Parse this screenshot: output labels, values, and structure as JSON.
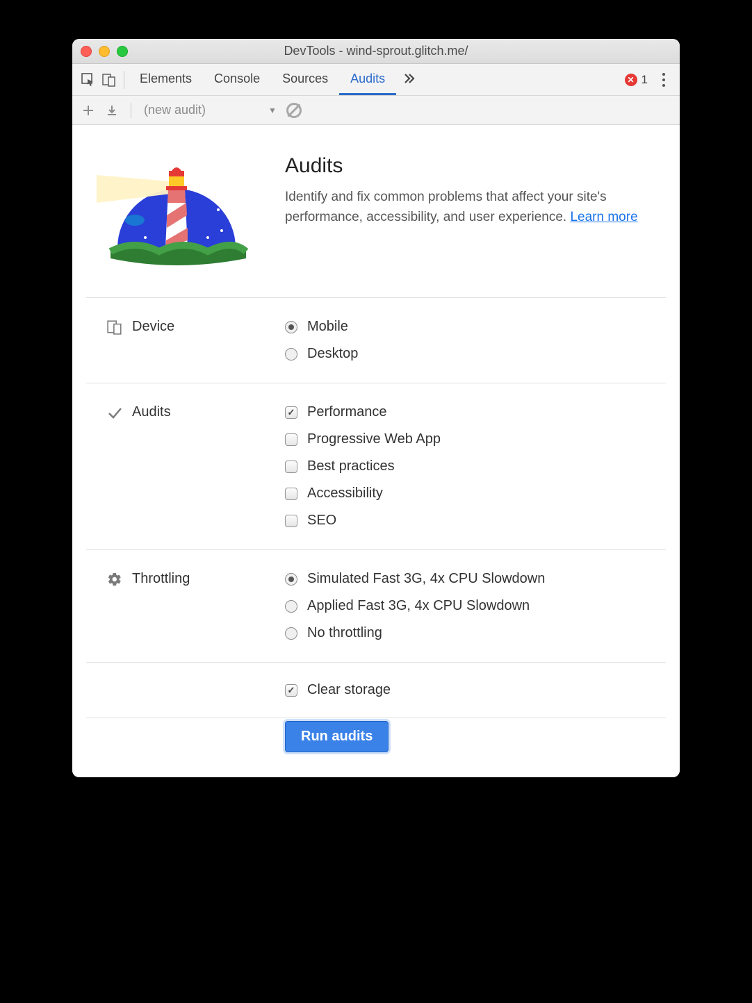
{
  "window": {
    "title": "DevTools - wind-sprout.glitch.me/"
  },
  "tabs": {
    "items": [
      "Elements",
      "Console",
      "Sources",
      "Audits"
    ],
    "active": "Audits",
    "error_count": "1"
  },
  "subbar": {
    "audit_select": "(new audit)"
  },
  "hero": {
    "title": "Audits",
    "desc": "Identify and fix common problems that affect your site's performance, accessibility, and user experience. ",
    "link": "Learn more"
  },
  "sections": {
    "device": {
      "label": "Device",
      "options": [
        {
          "label": "Mobile",
          "checked": true
        },
        {
          "label": "Desktop",
          "checked": false
        }
      ]
    },
    "audits": {
      "label": "Audits",
      "options": [
        {
          "label": "Performance",
          "checked": true
        },
        {
          "label": "Progressive Web App",
          "checked": false
        },
        {
          "label": "Best practices",
          "checked": false
        },
        {
          "label": "Accessibility",
          "checked": false
        },
        {
          "label": "SEO",
          "checked": false
        }
      ]
    },
    "throttling": {
      "label": "Throttling",
      "options": [
        {
          "label": "Simulated Fast 3G, 4x CPU Slowdown",
          "checked": true
        },
        {
          "label": "Applied Fast 3G, 4x CPU Slowdown",
          "checked": false
        },
        {
          "label": "No throttling",
          "checked": false
        }
      ]
    },
    "clear_storage": {
      "label": "Clear storage",
      "checked": true
    }
  },
  "run_button": "Run audits"
}
